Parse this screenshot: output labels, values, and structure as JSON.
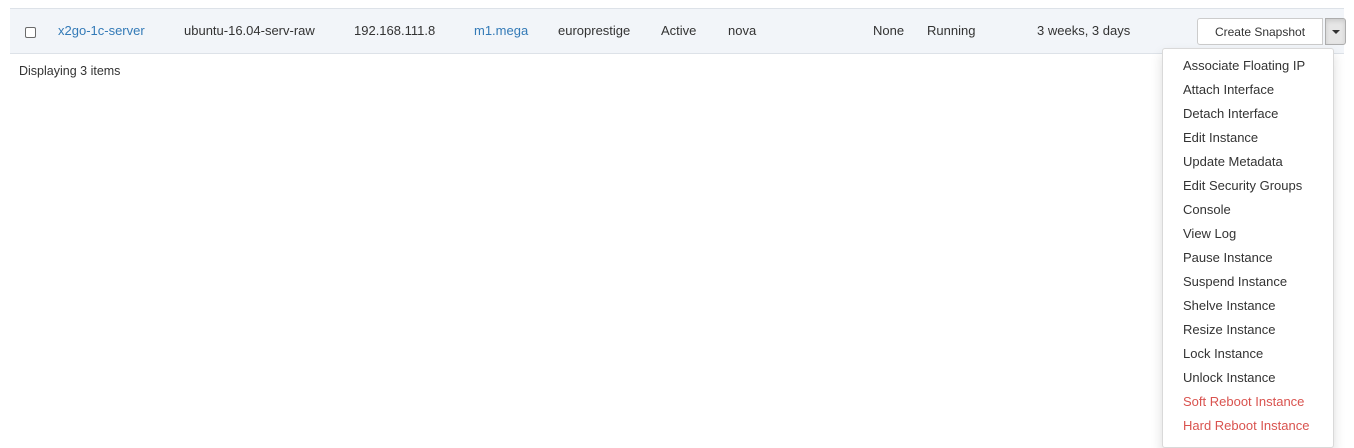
{
  "row": {
    "instance_name": "x2go-1c-server",
    "image_name": "ubuntu-16.04-serv-raw",
    "ip_address": "192.168.111.8",
    "flavor": "m1.mega",
    "key_pair": "europrestige",
    "status": "Active",
    "availability_zone": "nova",
    "task": "None",
    "power_state": "Running",
    "age": "3 weeks, 3 days"
  },
  "actions": {
    "primary_label": "Create Snapshot"
  },
  "footer": {
    "count_text": "Displaying 3 items"
  },
  "menu": {
    "items": [
      {
        "label": "Associate Floating IP",
        "danger": false
      },
      {
        "label": "Attach Interface",
        "danger": false
      },
      {
        "label": "Detach Interface",
        "danger": false
      },
      {
        "label": "Edit Instance",
        "danger": false
      },
      {
        "label": "Update Metadata",
        "danger": false
      },
      {
        "label": "Edit Security Groups",
        "danger": false
      },
      {
        "label": "Console",
        "danger": false
      },
      {
        "label": "View Log",
        "danger": false
      },
      {
        "label": "Pause Instance",
        "danger": false
      },
      {
        "label": "Suspend Instance",
        "danger": false
      },
      {
        "label": "Shelve Instance",
        "danger": false
      },
      {
        "label": "Resize Instance",
        "danger": false
      },
      {
        "label": "Lock Instance",
        "danger": false
      },
      {
        "label": "Unlock Instance",
        "danger": false
      },
      {
        "label": "Soft Reboot Instance",
        "danger": true
      },
      {
        "label": "Hard Reboot Instance",
        "danger": true
      }
    ]
  },
  "colors": {
    "link": "#337ab7",
    "danger": "#d9534f",
    "row_background": "#f2f5f9"
  }
}
